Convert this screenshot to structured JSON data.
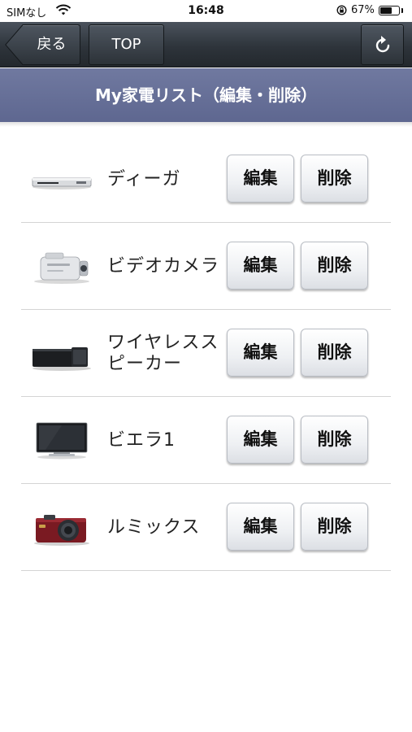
{
  "status_bar": {
    "carrier": "SIMなし",
    "time": "16:48",
    "battery_percent": "67%",
    "battery_level": 0.67
  },
  "nav": {
    "back_label": "戻る",
    "top_label": "TOP",
    "refresh_icon": "refresh-icon"
  },
  "title": "My家電リスト（編集・削除）",
  "devices": [
    {
      "name": "ディーガ",
      "icon": "recorder-icon",
      "edit_label": "編集",
      "delete_label": "削除"
    },
    {
      "name": "ビデオカメラ",
      "icon": "camcorder-icon",
      "edit_label": "編集",
      "delete_label": "削除"
    },
    {
      "name": "ワイヤレススピーカー",
      "icon": "speaker-icon",
      "edit_label": "編集",
      "delete_label": "削除"
    },
    {
      "name": "ビエラ1",
      "icon": "tv-icon",
      "edit_label": "編集",
      "delete_label": "削除"
    },
    {
      "name": "ルミックス",
      "icon": "camera-icon",
      "edit_label": "編集",
      "delete_label": "削除"
    }
  ],
  "colors": {
    "nav_bar": "#2e343b",
    "title_band": "#6670a0",
    "camera_body": "#7a1a22"
  }
}
